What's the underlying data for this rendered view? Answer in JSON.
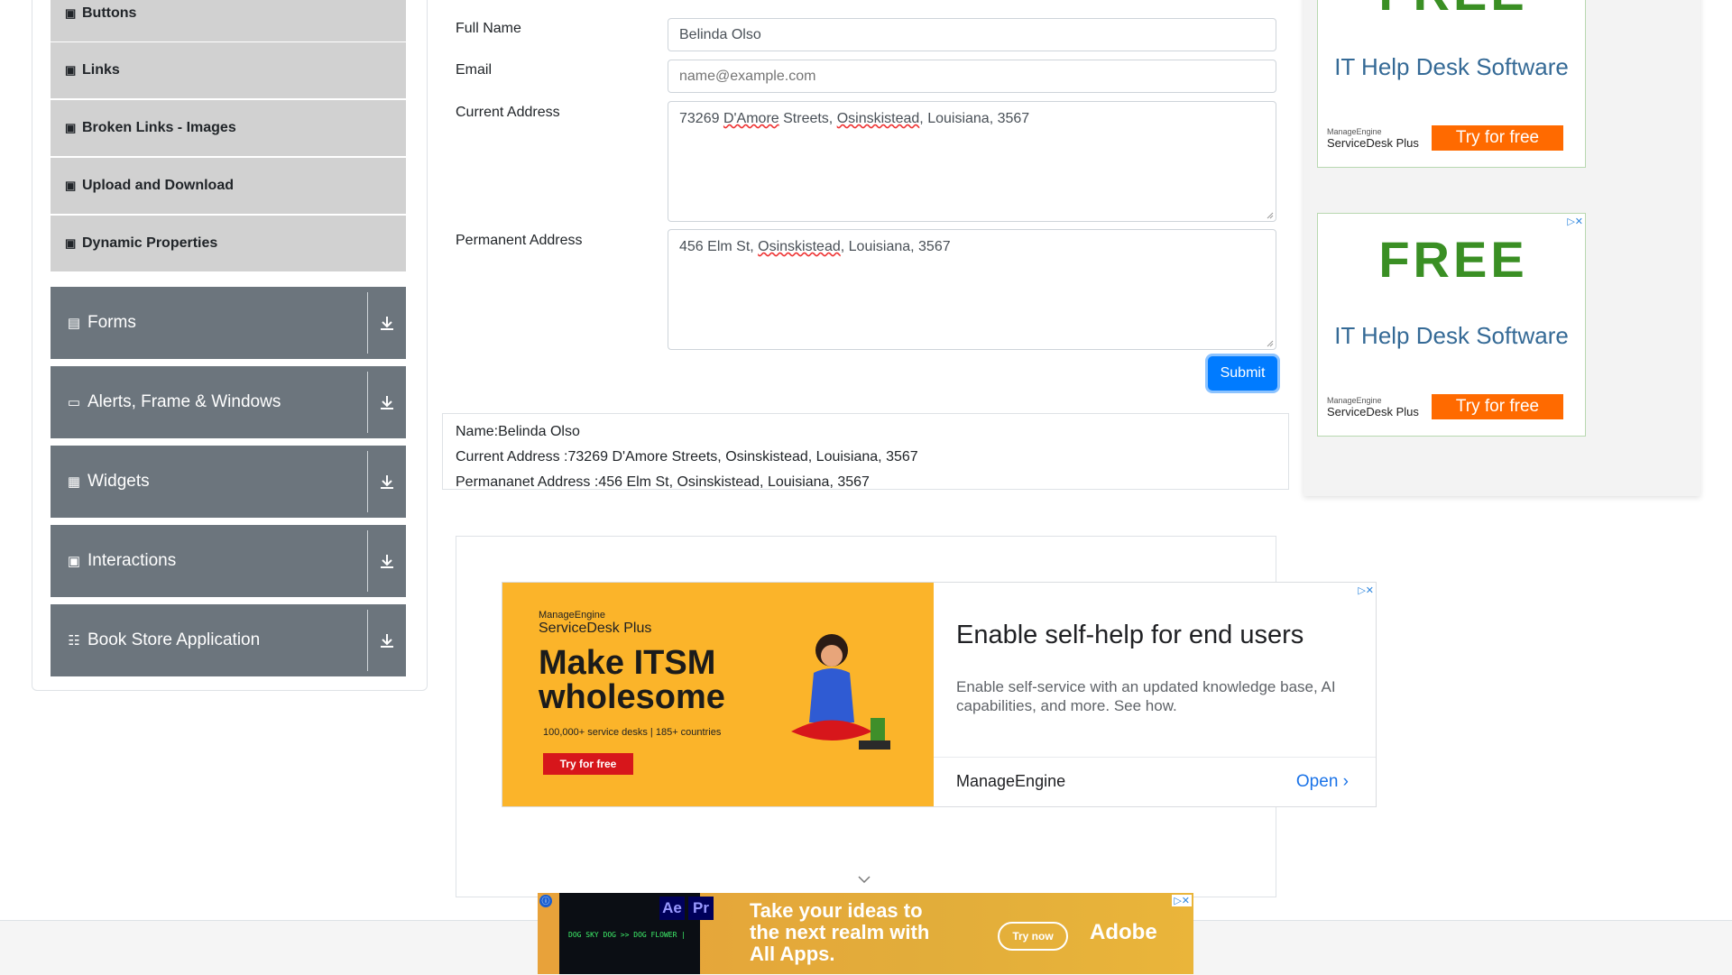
{
  "sidebar": {
    "sub_items": [
      "Buttons",
      "Links",
      "Broken Links - Images",
      "Upload and Download",
      "Dynamic Properties"
    ],
    "groups": [
      {
        "label": "Forms",
        "icon": "form-icon"
      },
      {
        "label": "Alerts, Frame & Windows",
        "icon": "window-icon"
      },
      {
        "label": "Widgets",
        "icon": "widgets-icon"
      },
      {
        "label": "Interactions",
        "icon": "interactions-icon"
      },
      {
        "label": "Book Store Application",
        "icon": "book-icon"
      }
    ]
  },
  "form": {
    "full_name_label": "Full Name",
    "full_name_value": "Belinda Olso",
    "email_label": "Email",
    "email_placeholder": "name@example.com",
    "current_address_label": "Current Address",
    "current_address_parts": [
      "73269 ",
      "D'Amore",
      " Streets, ",
      "Osinskistead",
      ", Louisiana, 3567"
    ],
    "permanent_address_label": "Permanent Address",
    "permanent_address_parts": [
      "456 Elm St, ",
      "Osinskistead",
      ", Louisiana, 3567"
    ],
    "submit_label": "Submit"
  },
  "output": {
    "name": "Name:Belinda Olso",
    "current_address": "Current Address :73269 D'Amore Streets, Osinskistead, Louisiana, 3567",
    "permanent_address": "Permananet Address :456 Elm St, Osinskistead, Louisiana, 3567"
  },
  "side_ads": [
    {
      "free": "FREE",
      "headline": "IT Help Desk Software",
      "brand_small": "ManageEngine",
      "brand": "ServiceDesk Plus",
      "cta": "Try for free"
    },
    {
      "free": "FREE",
      "headline": "IT Help Desk Software",
      "brand_small": "ManageEngine",
      "brand": "ServiceDesk Plus",
      "cta": "Try for free"
    }
  ],
  "banner_ad": {
    "brand_small": "ManageEngine",
    "brand": "ServiceDesk Plus",
    "big_line1": "Make ITSM",
    "big_line2": "wholesome",
    "small": "100,000+ service desks | 185+ countries",
    "cta": "Try for free",
    "title": "Enable self-help for end users",
    "subtitle": "Enable self-service with an updated knowledge base, AI capabilities, and more. See how.",
    "company": "ManageEngine",
    "open": "Open"
  },
  "adobe_ad": {
    "tagline": "DOG SKY DOG >> DOG FLOWER |",
    "ae": "Ae",
    "pr": "Pr",
    "line1": "Take your ideas to",
    "line2": "the next realm with",
    "line3": "All Apps.",
    "cta": "Try now",
    "logo": "Adobe"
  },
  "colors": {
    "sidebar_group": "#6c757d",
    "sidebar_sub": "#d1d1d1",
    "submit": "#007bff",
    "side_ad_green": "#3a8f24",
    "side_ad_orange": "#ff6a00",
    "banner_yellow": "#fbb42a"
  }
}
